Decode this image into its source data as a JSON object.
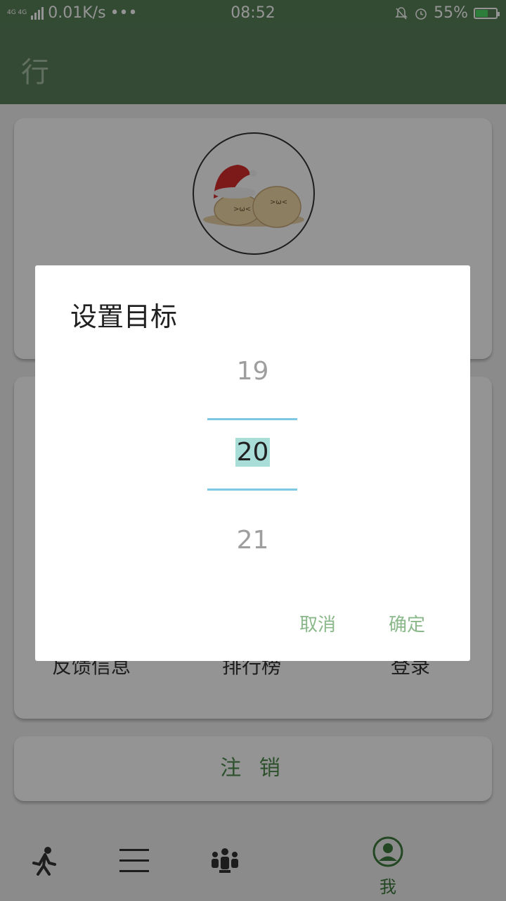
{
  "status_bar": {
    "network": "4G 4G",
    "speed": "0.01K/s",
    "more": "•••",
    "time": "08:52",
    "battery": "55%"
  },
  "app_bar": {
    "title": "行"
  },
  "menu": {
    "feedback": "反馈信息",
    "ranking": "排行榜",
    "login": "登录"
  },
  "logout_label": "注 销",
  "bottom_nav": {
    "me_label": "我"
  },
  "dialog": {
    "title": "设置目标",
    "prev_value": "19",
    "selected_value": "20",
    "next_value": "21",
    "cancel": "取消",
    "confirm": "确定"
  },
  "colors": {
    "primary_green": "#5a805b",
    "accent_text_green": "#8ab88a",
    "picker_line": "#7ec8e3"
  },
  "icons": [
    "signal-icon",
    "mute-bell-icon",
    "alarm-icon",
    "battery-icon",
    "walk-icon",
    "list-icon",
    "group-icon",
    "profile-icon"
  ]
}
